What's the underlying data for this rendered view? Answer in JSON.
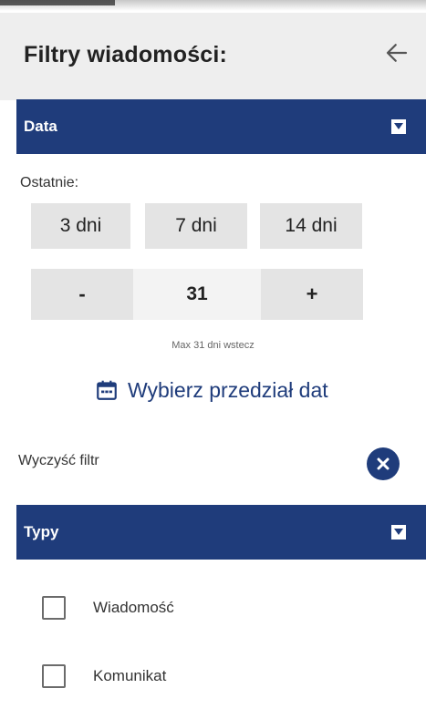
{
  "header": {
    "title": "Filtry wiadomości:"
  },
  "date_section": {
    "label": "Data",
    "recent_label": "Ostatnie:",
    "quick_ranges": [
      "3 dni",
      "7 dni",
      "14 dni"
    ],
    "stepper": {
      "minus_label": "-",
      "value": "31",
      "plus_label": "+"
    },
    "max_note": "Max 31 dni wstecz",
    "range_button_label": "Wybierz przedział dat"
  },
  "clear": {
    "label": "Wyczyść filtr"
  },
  "types_section": {
    "label": "Typy",
    "options": [
      "Wiadomość",
      "Komunikat"
    ]
  },
  "colors": {
    "accent": "#1f3c7b",
    "header_bg": "#eeeeee",
    "chip_bg": "#e4e4e4"
  },
  "icons": {
    "back": "arrow-left-icon",
    "toggle": "triangle-down-icon",
    "calendar": "calendar-icon",
    "clear": "close-circle-icon"
  }
}
